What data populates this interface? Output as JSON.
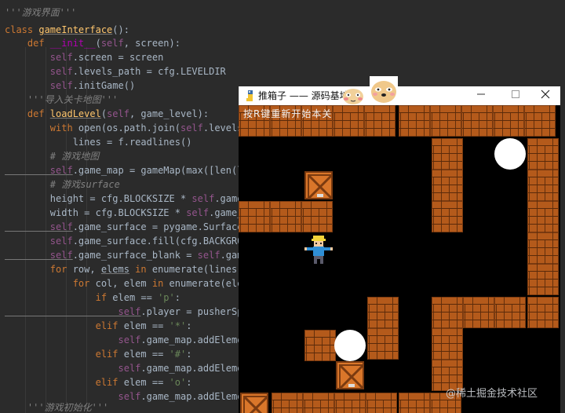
{
  "editor": {
    "lines": [
      {
        "parts": [
          {
            "t": "'''游戏界面'''",
            "c": "t-cmt"
          }
        ]
      },
      {
        "parts": [
          {
            "t": "class ",
            "c": "t-kw"
          },
          {
            "t": "gameInterface",
            "c": "t-fn t-und"
          },
          {
            "t": "():",
            "c": "t-pl"
          }
        ]
      },
      {
        "parts": [
          {
            "t": "    def ",
            "c": "t-kw"
          },
          {
            "t": "__init__",
            "c": "t-mag"
          },
          {
            "t": "(",
            "c": "t-pl"
          },
          {
            "t": "self",
            "c": "t-self"
          },
          {
            "t": ", screen):",
            "c": "t-pl"
          }
        ]
      },
      {
        "parts": [
          {
            "t": "        self",
            "c": "t-self"
          },
          {
            "t": ".screen = screen",
            "c": "t-pl"
          }
        ]
      },
      {
        "parts": [
          {
            "t": "        self",
            "c": "t-self"
          },
          {
            "t": ".levels_path = cfg.LEVELDIR",
            "c": "t-pl"
          }
        ]
      },
      {
        "parts": [
          {
            "t": "        self",
            "c": "t-self"
          },
          {
            "t": ".initGame()",
            "c": "t-pl"
          }
        ]
      },
      {
        "parts": [
          {
            "t": "    '''导入关卡地图'''",
            "c": "t-cmt"
          }
        ]
      },
      {
        "parts": [
          {
            "t": "    def ",
            "c": "t-kw"
          },
          {
            "t": "loadLevel",
            "c": "t-fn t-und"
          },
          {
            "t": "(",
            "c": "t-pl"
          },
          {
            "t": "self",
            "c": "t-self"
          },
          {
            "t": ", game_level):",
            "c": "t-pl"
          }
        ]
      },
      {
        "parts": [
          {
            "t": "        with ",
            "c": "t-kw"
          },
          {
            "t": "open(os.path.join(",
            "c": "t-pl"
          },
          {
            "t": "self",
            "c": "t-self"
          },
          {
            "t": ".levels_path",
            "c": "t-pl"
          }
        ]
      },
      {
        "parts": [
          {
            "t": "            lines = f.readlines()",
            "c": "t-pl"
          }
        ]
      },
      {
        "parts": [
          {
            "t": "        # 游戏地图",
            "c": "t-cmt"
          }
        ]
      },
      {
        "parts": [
          {
            "t": "        self",
            "c": "t-self t-und"
          },
          {
            "t": ".game_map = gameMap(max([len(line)",
            "c": "t-pl"
          }
        ]
      },
      {
        "parts": [
          {
            "t": "        # 游戏surface",
            "c": "t-cmt"
          }
        ]
      },
      {
        "parts": [
          {
            "t": "        height = cfg.BLOCKSIZE * ",
            "c": "t-pl"
          },
          {
            "t": "self",
            "c": "t-self"
          },
          {
            "t": ".game_map",
            "c": "t-pl"
          }
        ]
      },
      {
        "parts": [
          {
            "t": "        width = cfg.BLOCKSIZE * ",
            "c": "t-pl"
          },
          {
            "t": "self",
            "c": "t-self"
          },
          {
            "t": ".game_map.",
            "c": "t-pl"
          }
        ]
      },
      {
        "parts": [
          {
            "t": "        self",
            "c": "t-self t-und"
          },
          {
            "t": ".game_surface = pygame.Surface((wi",
            "c": "t-pl"
          }
        ]
      },
      {
        "parts": [
          {
            "t": "        self",
            "c": "t-self"
          },
          {
            "t": ".game_surface.fill(cfg.BACKGROUNDC",
            "c": "t-pl"
          }
        ]
      },
      {
        "parts": [
          {
            "t": "        self",
            "c": "t-self t-und"
          },
          {
            "t": ".game_surface_blank = ",
            "c": "t-pl"
          },
          {
            "t": "self",
            "c": "t-self"
          },
          {
            "t": ".game_su",
            "c": "t-pl"
          }
        ]
      },
      {
        "parts": [
          {
            "t": "        for ",
            "c": "t-kw"
          },
          {
            "t": "row, ",
            "c": "t-pl"
          },
          {
            "t": "elems",
            "c": "t-pl t-und"
          },
          {
            "t": " in ",
            "c": "t-kw"
          },
          {
            "t": "enumerate(lines):",
            "c": "t-pl"
          }
        ]
      },
      {
        "parts": [
          {
            "t": "            for ",
            "c": "t-kw"
          },
          {
            "t": "col, elem ",
            "c": "t-pl"
          },
          {
            "t": "in ",
            "c": "t-kw"
          },
          {
            "t": "enumerate(elems):",
            "c": "t-pl"
          }
        ]
      },
      {
        "parts": [
          {
            "t": "                if ",
            "c": "t-kw"
          },
          {
            "t": "elem == ",
            "c": "t-pl"
          },
          {
            "t": "'p'",
            "c": "t-str"
          },
          {
            "t": ":",
            "c": "t-pl"
          }
        ]
      },
      {
        "parts": [
          {
            "t": "                    self",
            "c": "t-self t-und"
          },
          {
            "t": ".player = pusherSprite",
            "c": "t-pl"
          }
        ]
      },
      {
        "parts": [
          {
            "t": "                elif ",
            "c": "t-kw"
          },
          {
            "t": "elem == ",
            "c": "t-pl"
          },
          {
            "t": "'*'",
            "c": "t-str"
          },
          {
            "t": ":",
            "c": "t-pl"
          }
        ]
      },
      {
        "parts": [
          {
            "t": "                    self",
            "c": "t-self"
          },
          {
            "t": ".game_map.addElement('",
            "c": "t-pl"
          }
        ]
      },
      {
        "parts": [
          {
            "t": "                elif ",
            "c": "t-kw"
          },
          {
            "t": "elem == ",
            "c": "t-pl"
          },
          {
            "t": "'#'",
            "c": "t-str"
          },
          {
            "t": ":",
            "c": "t-pl"
          }
        ]
      },
      {
        "parts": [
          {
            "t": "                    self",
            "c": "t-self"
          },
          {
            "t": ".game_map.addElement('",
            "c": "t-pl"
          }
        ]
      },
      {
        "parts": [
          {
            "t": "                elif ",
            "c": "t-kw"
          },
          {
            "t": "elem == ",
            "c": "t-pl"
          },
          {
            "t": "'o'",
            "c": "t-str"
          },
          {
            "t": ":",
            "c": "t-pl"
          }
        ]
      },
      {
        "parts": [
          {
            "t": "                    self",
            "c": "t-self"
          },
          {
            "t": ".game_map.addElement(",
            "c": "t-pl"
          }
        ]
      },
      {
        "parts": [
          {
            "t": "    '''游戏初始化'''",
            "c": "t-cmt"
          }
        ]
      }
    ]
  },
  "window": {
    "title": "推箱子 —— 源码基地:",
    "min_icon": "minimize-icon",
    "max_icon": "maximize-icon",
    "close_icon": "close-icon"
  },
  "game": {
    "hint": "按R键重新开始本关",
    "colors": {
      "brick": "#b45a1b",
      "box": "#d9762a",
      "target": "#ffffff",
      "background": "#000000"
    }
  },
  "watermark": "@稀土掘金技术社区"
}
